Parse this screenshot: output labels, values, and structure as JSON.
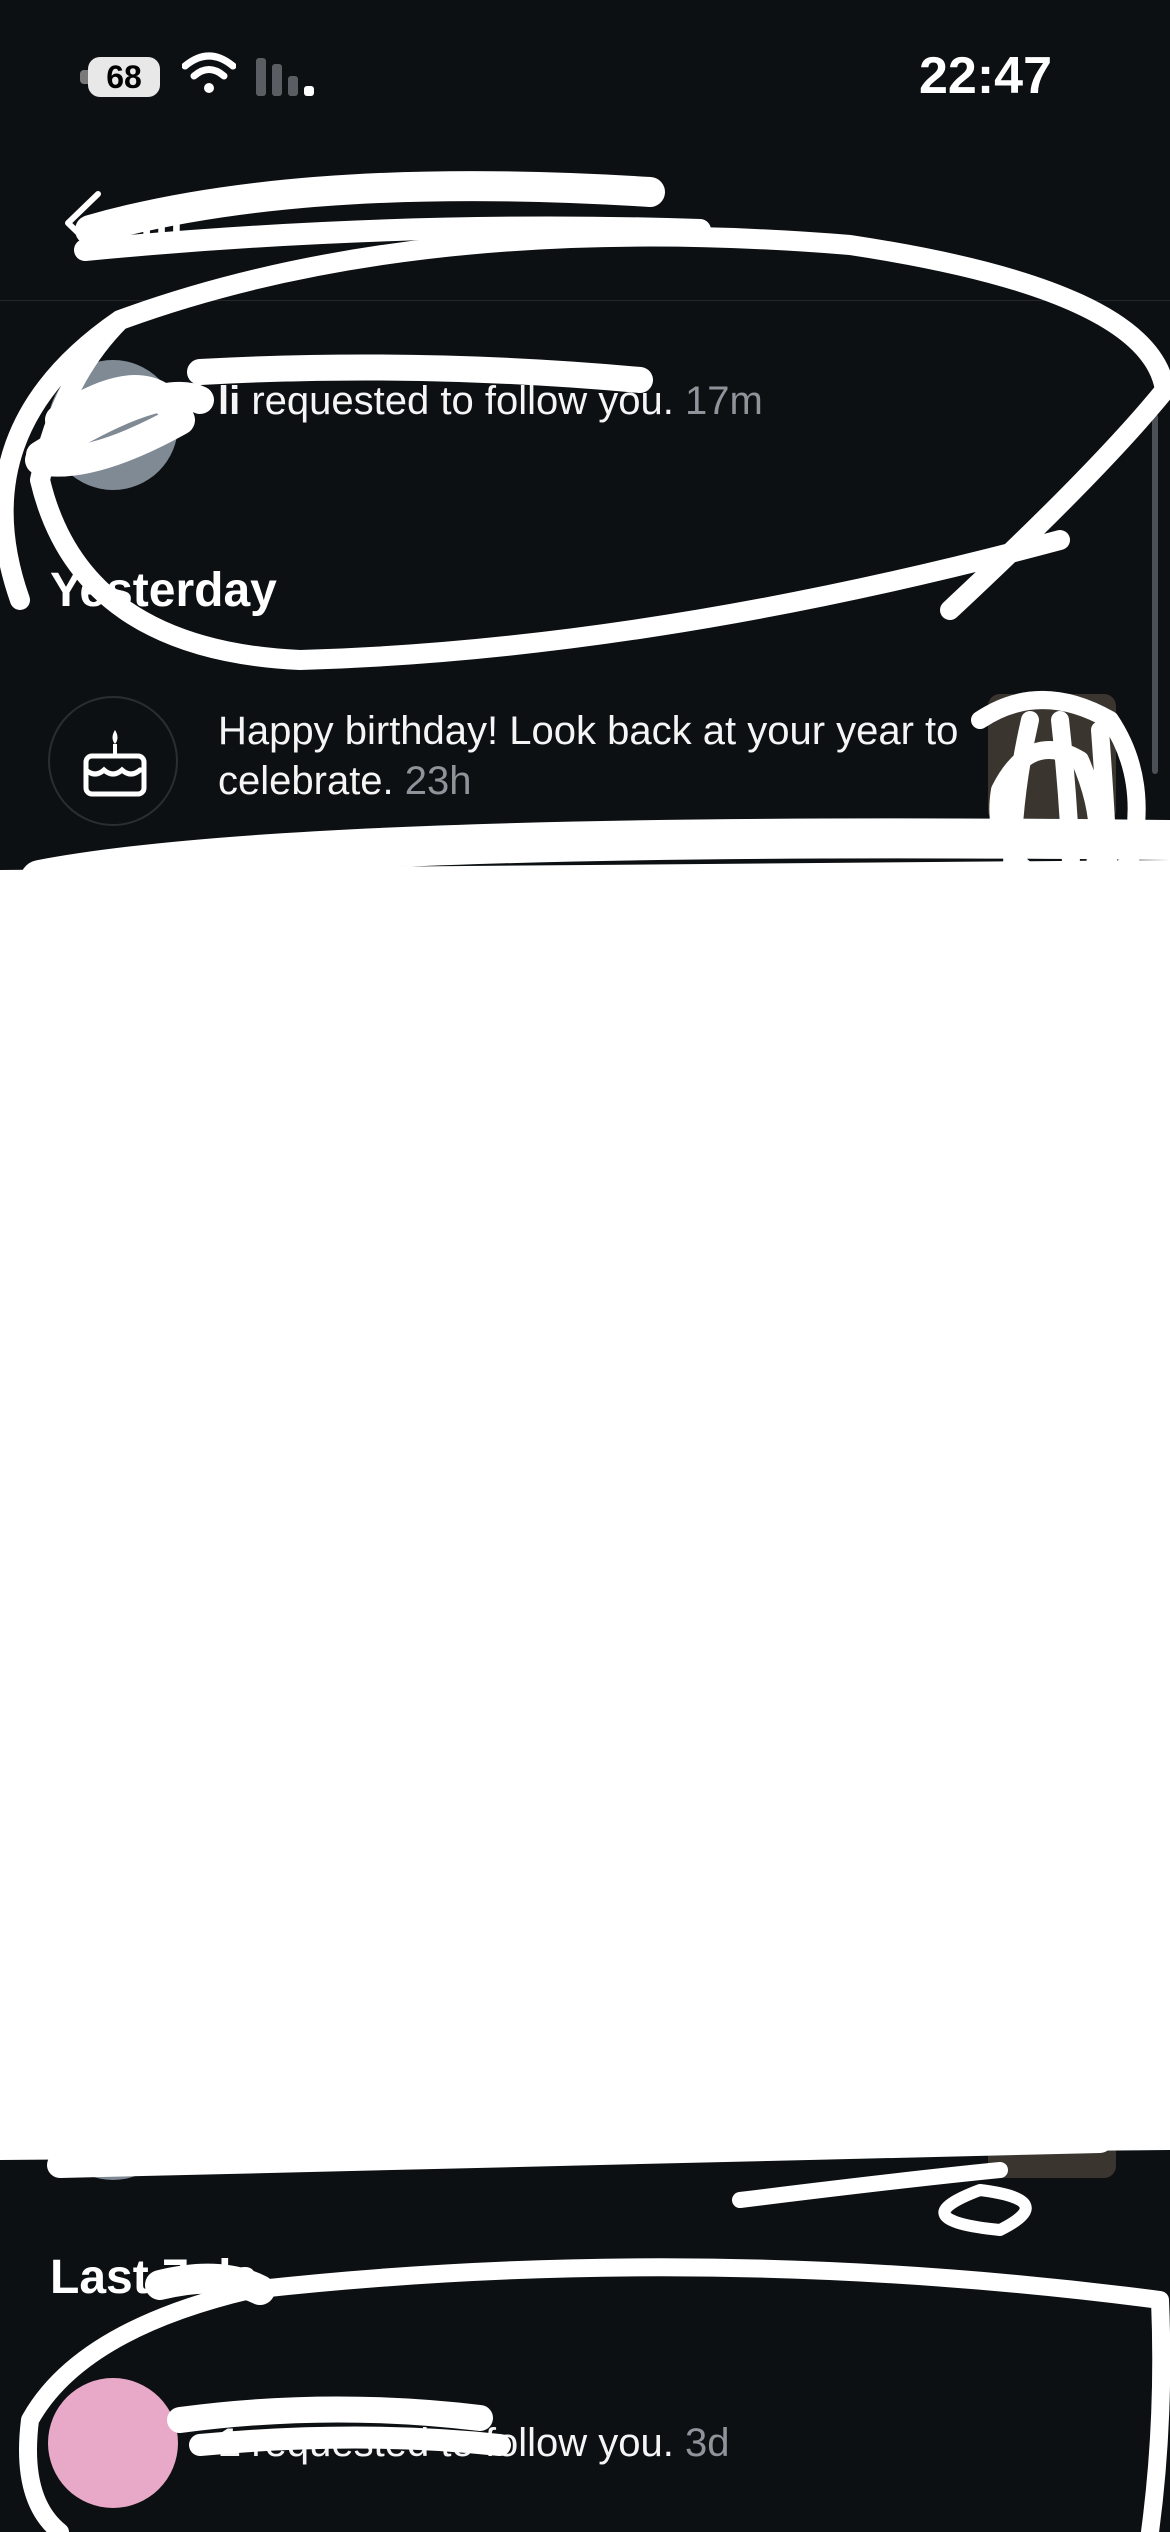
{
  "status_bar": {
    "battery": "68",
    "time": "22:47",
    "icons": [
      "battery-icon",
      "wifi-icon",
      "cellular-signal-icon"
    ]
  },
  "header": {
    "back_icon": "chevron-left-icon",
    "title": "m"
  },
  "notifications": {
    "top_item": {
      "username": "li",
      "text": " requested to follow you.",
      "time": "17m"
    },
    "sections": [
      {
        "title": "Yesterday",
        "items": [
          {
            "icon": "birthday-cake-icon",
            "text": "Happy birthday! Look back at your year to celebrate.",
            "time": "23h"
          }
        ]
      },
      {
        "title": "Last 7 da",
        "items": [
          {
            "username": "1",
            "text": " requested to follow you.",
            "time": "3d",
            "avatar_color": "#e8a8c8"
          }
        ]
      }
    ]
  },
  "colors": {
    "background": "#0d1013",
    "text": "#f5f5f5",
    "secondary_text": "#8e949a",
    "redaction": "#ffffff"
  }
}
